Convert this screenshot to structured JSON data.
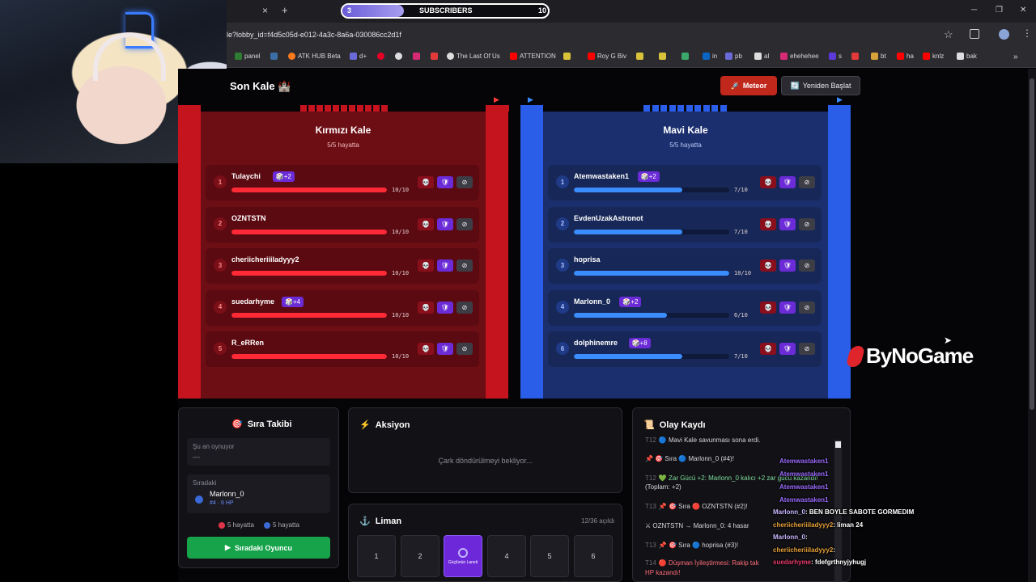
{
  "browser": {
    "tab_close": "×",
    "tab_add": "+",
    "url": "le?lobby_id=f4d5c05d-e012-4a3c-8a6a-030086cc2d1f",
    "star_icon": "star-icon",
    "bookmarks": [
      "panel",
      "",
      "ATK HUB Beta",
      "d+",
      "",
      "",
      "",
      "The Last Of Us",
      "ATTENTION",
      "",
      "Roy G Biv",
      "",
      "",
      "",
      "in",
      "pb",
      "al",
      "ehehehee",
      "s",
      "",
      "bt",
      "ha",
      "knlz",
      "bak"
    ],
    "window_controls": [
      "─",
      "❐",
      "✕"
    ]
  },
  "subscribers": {
    "count": "3",
    "label": "SUBSCRIBERS",
    "goal": "10",
    "progress": 0.3
  },
  "header": {
    "title": "Son Kale 🏰",
    "meteor_label": "Meteor",
    "meteor_icon": "🚀",
    "restart_label": "Yeniden Başlat",
    "restart_icon": "🔄"
  },
  "red_castle": {
    "name": "Kırmızı Kale",
    "alive": "5/5 hayatta",
    "color": "#a8141c",
    "players": [
      {
        "num": "1",
        "name": "Tulaychi",
        "badge": "🎲+2",
        "hp": "10/10",
        "hp_frac": 1.0
      },
      {
        "num": "2",
        "name": "OZNTSTN",
        "badge": "",
        "hp": "10/10",
        "hp_frac": 1.0
      },
      {
        "num": "3",
        "name": "cheriicheriiiladyyy2",
        "badge": "",
        "hp": "10/10",
        "hp_frac": 1.0
      },
      {
        "num": "4",
        "name": "suedarhyme",
        "badge": "🎲+4",
        "hp": "10/10",
        "hp_frac": 1.0
      },
      {
        "num": "5",
        "name": "R_eRRen",
        "badge": "",
        "hp": "10/10",
        "hp_frac": 1.0
      }
    ]
  },
  "blue_castle": {
    "name": "Mavi Kale",
    "alive": "5/5 hayatta",
    "color": "#1f4fcf",
    "players": [
      {
        "num": "1",
        "name": "Atemwastaken1",
        "badge": "🎲+2",
        "hp": "7/10",
        "hp_frac": 0.7
      },
      {
        "num": "2",
        "name": "EvdenUzakAstronot",
        "badge": "",
        "hp": "7/10",
        "hp_frac": 0.7
      },
      {
        "num": "3",
        "name": "hoprisa",
        "badge": "",
        "hp": "10/10",
        "hp_frac": 1.0
      },
      {
        "num": "4",
        "name": "Marlonn_0",
        "badge": "🎲+2",
        "hp": "6/10",
        "hp_frac": 0.6
      },
      {
        "num": "6",
        "name": "dolphinemre",
        "badge": "🎲+8",
        "hp": "7/10",
        "hp_frac": 0.7
      }
    ]
  },
  "action_icons": [
    "💀",
    "🛡",
    "⊘"
  ],
  "turn_panel": {
    "title": "Sıra Takibi",
    "icon": "🎯",
    "current_label": "Şu an oynuyor",
    "current_value": "—",
    "next_label": "Sıradaki",
    "next_name": "Marlonn_0",
    "next_detail": "#4 · 6 HP",
    "red_alive": "5 hayatta",
    "blue_alive": "5 hayatta",
    "next_button": "Sıradaki Oyuncu",
    "next_button_icon": "▶"
  },
  "action_panel": {
    "title": "Aksiyon",
    "icon": "⚡",
    "waiting": "Çark döndürülmeyi bekliyor..."
  },
  "harbor_panel": {
    "title": "Liman",
    "icon": "⚓",
    "opened": "12/36 açıldı",
    "cells": [
      "1",
      "2",
      "Güçlünün Laneti",
      "4",
      "5",
      "6"
    ]
  },
  "log_panel": {
    "title": "Olay Kaydı",
    "icon": "📜",
    "lines": [
      {
        "t": "T12",
        "text": "🔵 Mavi Kale savunması sona erdi."
      },
      {
        "t": "",
        "text": "📌 🎯 Sıra 🔵 Marlonn_0 (#4)!"
      },
      {
        "t": "T12",
        "text": "💚 Zar Gücü +2: Marlonn_0 kalıcı +2 zar gücü kazandı!"
      },
      {
        "t": "",
        "text": "(Toplam: +2)"
      },
      {
        "t": "T13",
        "text": "📌 🎯 Sıra 🔴 OZNTSTN (#2)!"
      },
      {
        "t": "",
        "text": "⚔ OZNTSTN → Marlonn_0: 4 hasar"
      },
      {
        "t": "T13",
        "text": "📌 🎯 Sıra 🔵 hoprisa (#3)!"
      },
      {
        "t": "T14",
        "text": "🔴 Düşman İyileştirmesi: Rakip tak"
      },
      {
        "t": "",
        "text": "HP kazandı!"
      }
    ]
  },
  "chat": [
    {
      "name": "Atemwastaken1",
      "msg": "",
      "color": "#9b6bff"
    },
    {
      "name": "Atemwastaken1",
      "msg": "",
      "color": "#9b6bff"
    },
    {
      "name": "Atemwastaken1",
      "msg": "",
      "color": "#9b6bff"
    },
    {
      "name": "Atemwastaken1",
      "msg": "",
      "color": "#9b6bff"
    },
    {
      "name": "Marlonn_0",
      "msg": ": BEN BOYLE SABOTE GORMEDIM",
      "color": "#c9b6ff"
    },
    {
      "name": "cheriicheriiiladyyy2",
      "msg": ": liman 24",
      "color": "#e8a23a"
    },
    {
      "name": "Marlonn_0",
      "msg": ":",
      "color": "#c9b6ff"
    },
    {
      "name": "cheriicheriiiladyyy2",
      "msg": ":",
      "color": "#e8a23a"
    },
    {
      "name": "suedarhyme",
      "msg": ": fdefgrthnyjyhugj",
      "color": "#e83a6a"
    }
  ],
  "brand": {
    "logo": "ByNoGame"
  }
}
